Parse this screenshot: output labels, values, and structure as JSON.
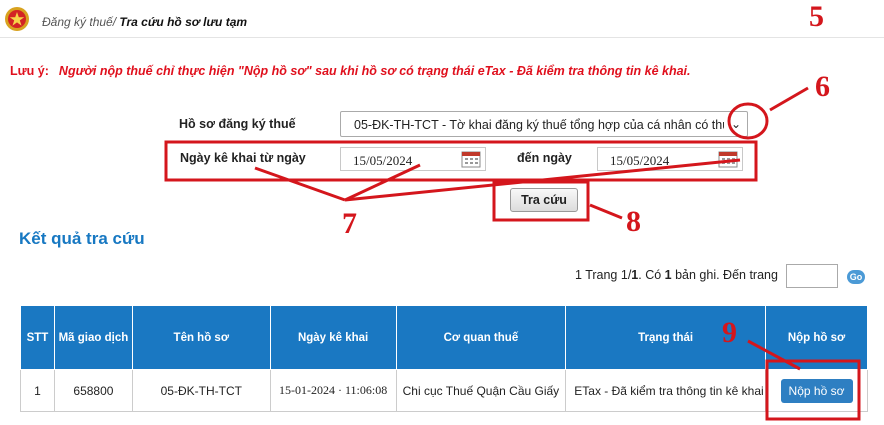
{
  "breadcrumb": {
    "parent": "Đăng ký thuế/",
    "current": "Tra cứu hồ sơ lưu tạm"
  },
  "note": {
    "label": "Lưu ý:",
    "text": "Người nộp thuế chỉ thực hiện \"Nộp hồ sơ\" sau khi hồ sơ có trạng thái eTax - Đã kiểm tra thông tin kê khai."
  },
  "form": {
    "dossier_label": "Hồ sơ đăng ký thuế",
    "dossier_value": "05-ĐK-TH-TCT - Tờ khai đăng ký thuế tổng hợp của cá nhân có thu",
    "from_label": "Ngày kê khai từ ngày",
    "from_value": "15/05/2024",
    "to_label": "đến ngày",
    "to_value": "15/05/2024",
    "search_button": "Tra cứu"
  },
  "results": {
    "title": "Kết quả tra cứu",
    "pagination": {
      "pre": "1  Trang 1/",
      "page_count": "1",
      "mid": ". Có ",
      "record_count": "1",
      "post": " bản ghi. Đến trang"
    },
    "go_label": "Go",
    "columns": [
      "STT",
      "Mã giao dịch",
      "Tên hồ sơ",
      "Ngày kê khai",
      "Cơ quan thuế",
      "Trạng thái",
      "Nộp hồ sơ"
    ],
    "rows": [
      {
        "stt": "1",
        "transaction_code": "658800",
        "dossier_name": "05-ĐK-TH-TCT",
        "declared_at": "15-01-2024 · 11:06:08",
        "tax_office": "Chi cục Thuế Quận Cầu Giấy",
        "status": "ETax - Đã kiểm tra thông tin kê khai",
        "action": "Nộp hồ sơ"
      }
    ]
  },
  "annotations": {
    "n5": "5",
    "n6": "6",
    "n7": "7",
    "n8": "8",
    "n9": "9"
  },
  "colors": {
    "accent_red": "#d4161c",
    "table_header": "#1a78c2",
    "title_blue": "#1778c2"
  }
}
